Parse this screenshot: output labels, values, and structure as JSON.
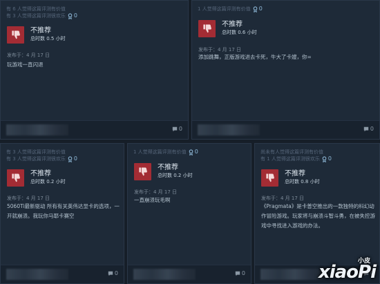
{
  "reviews": [
    {
      "helpful_line1": "有 6 人觉得这篇评测有价值",
      "helpful_line2": "有 3 人觉得这篇评测很欢乐",
      "awards": "0",
      "verdict": "不推荐",
      "hours": "总时数 0.5 小时",
      "posted": "发布于：4 月 17 日",
      "body": "玩游戏一直闪退",
      "comments": "0"
    },
    {
      "helpful_line1": "1 人觉得这篇评测有价值",
      "awards": "0",
      "verdict": "不推荐",
      "hours": "总时数 0.6 小时",
      "posted": "发布于：4 月 17 日",
      "body": "添加跳舞，正版游戏进去卡死，牛大了卡嫂，你=",
      "comments": "0"
    },
    {
      "helpful_line1": "有 3 人觉得这篇评测有价值",
      "helpful_line2": "有 3 人觉得这篇评测很欢乐",
      "awards": "0",
      "verdict": "不推荐",
      "hours": "总时数 0.2 小时",
      "posted": "发布于：4 月 17 日",
      "body": "5060Ti最新驱动 所有有关英伟达显卡的选项，一开就崩溃。我玩你马耶卡赛空",
      "comments": "0"
    },
    {
      "helpful_line1": "1 人觉得这篇评测有价值",
      "awards": "0",
      "verdict": "不推荐",
      "hours": "总时数 0.2 小时",
      "posted": "发布于：4 月 17 日",
      "body": "一直崩溃玩毛啊",
      "comments": "0"
    },
    {
      "helpful_line1": "尚未有人觉得这篇评测有价值",
      "helpful_line2": "有 1 人觉得这篇评测很欢乐",
      "awards": "0",
      "verdict": "不推荐",
      "hours": "总时数 0.8 小时",
      "posted": "发布于：4 月 17 日",
      "body": "《Pragmata》是卡普空推出的一款独特的科幻动作冒险游戏。玩家将与崩溃斗智斗勇，在被失控游戏中寻找进入游戏的办法。",
      "comments": "0"
    }
  ],
  "watermark": {
    "main": "xiaoPi",
    "top": "小皮"
  },
  "colors": {
    "thumb_down_bg": "#a32c34",
    "card_bg": "#1e2a38",
    "page_bg": "#161e28"
  }
}
